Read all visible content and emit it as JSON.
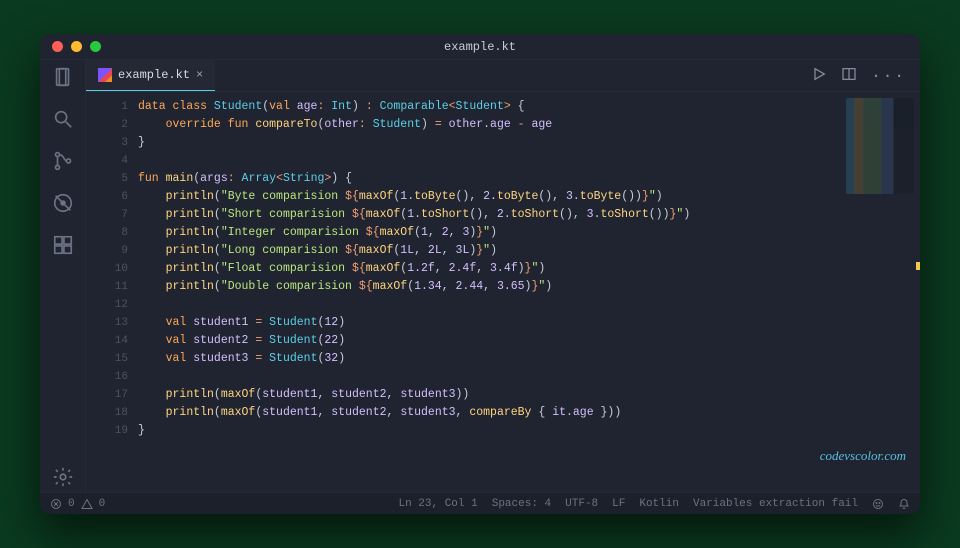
{
  "window": {
    "title": "example.kt"
  },
  "tabs": {
    "active": {
      "label": "example.kt"
    }
  },
  "watermark": "codevscolor.com",
  "status": {
    "errors": "0",
    "warnings": "0",
    "cursor": "Ln 23, Col 1",
    "spaces": "Spaces: 4",
    "encoding": "UTF-8",
    "eol": "LF",
    "language": "Kotlin",
    "message": "Variables extraction fail"
  },
  "code": {
    "lines": [
      {
        "n": 1,
        "tokens": [
          [
            "kw",
            "data class "
          ],
          [
            "type",
            "Student"
          ],
          [
            "pun",
            "("
          ],
          [
            "kw",
            "val "
          ],
          [
            "id",
            "age"
          ],
          [
            "op",
            ": "
          ],
          [
            "type",
            "Int"
          ],
          [
            "pun",
            ") "
          ],
          [
            "op",
            ": "
          ],
          [
            "type",
            "Comparable"
          ],
          [
            "op",
            "<"
          ],
          [
            "type",
            "Student"
          ],
          [
            "op",
            "> "
          ],
          [
            "pun",
            "{"
          ]
        ]
      },
      {
        "n": 2,
        "indent": 1,
        "tokens": [
          [
            "kw",
            "override fun "
          ],
          [
            "fn",
            "compareTo"
          ],
          [
            "pun",
            "("
          ],
          [
            "id",
            "other"
          ],
          [
            "op",
            ": "
          ],
          [
            "type",
            "Student"
          ],
          [
            "pun",
            ") "
          ],
          [
            "op",
            "= "
          ],
          [
            "id",
            "other"
          ],
          [
            "pun",
            "."
          ],
          [
            "id",
            "age"
          ],
          [
            "op",
            " - "
          ],
          [
            "id",
            "age"
          ]
        ]
      },
      {
        "n": 3,
        "tokens": [
          [
            "pun",
            "}"
          ]
        ]
      },
      {
        "n": 4,
        "tokens": []
      },
      {
        "n": 5,
        "tokens": [
          [
            "kw",
            "fun "
          ],
          [
            "fn",
            "main"
          ],
          [
            "pun",
            "("
          ],
          [
            "id",
            "args"
          ],
          [
            "op",
            ": "
          ],
          [
            "type",
            "Array"
          ],
          [
            "op",
            "<"
          ],
          [
            "type",
            "String"
          ],
          [
            "op",
            ">"
          ],
          [
            "pun",
            ") {"
          ]
        ]
      },
      {
        "n": 6,
        "indent": 1,
        "tokens": [
          [
            "fn",
            "println"
          ],
          [
            "pun",
            "("
          ],
          [
            "str",
            "\"Byte comparision "
          ],
          [
            "op",
            "${"
          ],
          [
            "fn",
            "maxOf"
          ],
          [
            "pun",
            "("
          ],
          [
            "num",
            "1"
          ],
          [
            "pun",
            "."
          ],
          [
            "fn",
            "toByte"
          ],
          [
            "pun",
            "(), "
          ],
          [
            "num",
            "2"
          ],
          [
            "pun",
            "."
          ],
          [
            "fn",
            "toByte"
          ],
          [
            "pun",
            "(), "
          ],
          [
            "num",
            "3"
          ],
          [
            "pun",
            "."
          ],
          [
            "fn",
            "toByte"
          ],
          [
            "pun",
            "())"
          ],
          [
            "op",
            "}"
          ],
          [
            "str",
            "\""
          ],
          [
            "pun",
            ")"
          ]
        ]
      },
      {
        "n": 7,
        "indent": 1,
        "tokens": [
          [
            "fn",
            "println"
          ],
          [
            "pun",
            "("
          ],
          [
            "str",
            "\"Short comparision "
          ],
          [
            "op",
            "${"
          ],
          [
            "fn",
            "maxOf"
          ],
          [
            "pun",
            "("
          ],
          [
            "num",
            "1"
          ],
          [
            "pun",
            "."
          ],
          [
            "fn",
            "toShort"
          ],
          [
            "pun",
            "(), "
          ],
          [
            "num",
            "2"
          ],
          [
            "pun",
            "."
          ],
          [
            "fn",
            "toShort"
          ],
          [
            "pun",
            "(), "
          ],
          [
            "num",
            "3"
          ],
          [
            "pun",
            "."
          ],
          [
            "fn",
            "toShort"
          ],
          [
            "pun",
            "())"
          ],
          [
            "op",
            "}"
          ],
          [
            "str",
            "\""
          ],
          [
            "pun",
            ")"
          ]
        ]
      },
      {
        "n": 8,
        "indent": 1,
        "tokens": [
          [
            "fn",
            "println"
          ],
          [
            "pun",
            "("
          ],
          [
            "str",
            "\"Integer comparision "
          ],
          [
            "op",
            "${"
          ],
          [
            "fn",
            "maxOf"
          ],
          [
            "pun",
            "("
          ],
          [
            "num",
            "1"
          ],
          [
            "pun",
            ", "
          ],
          [
            "num",
            "2"
          ],
          [
            "pun",
            ", "
          ],
          [
            "num",
            "3"
          ],
          [
            "pun",
            ")"
          ],
          [
            "op",
            "}"
          ],
          [
            "str",
            "\""
          ],
          [
            "pun",
            ")"
          ]
        ]
      },
      {
        "n": 9,
        "indent": 1,
        "tokens": [
          [
            "fn",
            "println"
          ],
          [
            "pun",
            "("
          ],
          [
            "str",
            "\"Long comparision "
          ],
          [
            "op",
            "${"
          ],
          [
            "fn",
            "maxOf"
          ],
          [
            "pun",
            "("
          ],
          [
            "num",
            "1L"
          ],
          [
            "pun",
            ", "
          ],
          [
            "num",
            "2L"
          ],
          [
            "pun",
            ", "
          ],
          [
            "num",
            "3L"
          ],
          [
            "pun",
            ")"
          ],
          [
            "op",
            "}"
          ],
          [
            "str",
            "\""
          ],
          [
            "pun",
            ")"
          ]
        ]
      },
      {
        "n": 10,
        "indent": 1,
        "tokens": [
          [
            "fn",
            "println"
          ],
          [
            "pun",
            "("
          ],
          [
            "str",
            "\"Float comparision "
          ],
          [
            "op",
            "${"
          ],
          [
            "fn",
            "maxOf"
          ],
          [
            "pun",
            "("
          ],
          [
            "num",
            "1.2f"
          ],
          [
            "pun",
            ", "
          ],
          [
            "num",
            "2.4f"
          ],
          [
            "pun",
            ", "
          ],
          [
            "num",
            "3.4f"
          ],
          [
            "pun",
            ")"
          ],
          [
            "op",
            "}"
          ],
          [
            "str",
            "\""
          ],
          [
            "pun",
            ")"
          ]
        ]
      },
      {
        "n": 11,
        "indent": 1,
        "tokens": [
          [
            "fn",
            "println"
          ],
          [
            "pun",
            "("
          ],
          [
            "str",
            "\"Double comparision "
          ],
          [
            "op",
            "${"
          ],
          [
            "fn",
            "maxOf"
          ],
          [
            "pun",
            "("
          ],
          [
            "num",
            "1.34"
          ],
          [
            "pun",
            ", "
          ],
          [
            "num",
            "2.44"
          ],
          [
            "pun",
            ", "
          ],
          [
            "num",
            "3.65"
          ],
          [
            "pun",
            ")"
          ],
          [
            "op",
            "}"
          ],
          [
            "str",
            "\""
          ],
          [
            "pun",
            ")"
          ]
        ]
      },
      {
        "n": 12,
        "tokens": []
      },
      {
        "n": 13,
        "indent": 1,
        "tokens": [
          [
            "kw",
            "val "
          ],
          [
            "id",
            "student1"
          ],
          [
            "op",
            " = "
          ],
          [
            "type",
            "Student"
          ],
          [
            "pun",
            "("
          ],
          [
            "num",
            "12"
          ],
          [
            "pun",
            ")"
          ]
        ]
      },
      {
        "n": 14,
        "indent": 1,
        "tokens": [
          [
            "kw",
            "val "
          ],
          [
            "id",
            "student2"
          ],
          [
            "op",
            " = "
          ],
          [
            "type",
            "Student"
          ],
          [
            "pun",
            "("
          ],
          [
            "num",
            "22"
          ],
          [
            "pun",
            ")"
          ]
        ]
      },
      {
        "n": 15,
        "indent": 1,
        "tokens": [
          [
            "kw",
            "val "
          ],
          [
            "id",
            "student3"
          ],
          [
            "op",
            " = "
          ],
          [
            "type",
            "Student"
          ],
          [
            "pun",
            "("
          ],
          [
            "num",
            "32"
          ],
          [
            "pun",
            ")"
          ]
        ]
      },
      {
        "n": 16,
        "tokens": []
      },
      {
        "n": 17,
        "indent": 1,
        "tokens": [
          [
            "fn",
            "println"
          ],
          [
            "pun",
            "("
          ],
          [
            "fn",
            "maxOf"
          ],
          [
            "pun",
            "("
          ],
          [
            "id",
            "student1"
          ],
          [
            "pun",
            ", "
          ],
          [
            "id",
            "student2"
          ],
          [
            "pun",
            ", "
          ],
          [
            "id",
            "student3"
          ],
          [
            "pun",
            "))"
          ]
        ]
      },
      {
        "n": 18,
        "indent": 1,
        "tokens": [
          [
            "fn",
            "println"
          ],
          [
            "pun",
            "("
          ],
          [
            "fn",
            "maxOf"
          ],
          [
            "pun",
            "("
          ],
          [
            "id",
            "student1"
          ],
          [
            "pun",
            ", "
          ],
          [
            "id",
            "student2"
          ],
          [
            "pun",
            ", "
          ],
          [
            "id",
            "student3"
          ],
          [
            "pun",
            ", "
          ],
          [
            "fn",
            "compareBy"
          ],
          [
            "pun",
            " { "
          ],
          [
            "id",
            "it"
          ],
          [
            "pun",
            "."
          ],
          [
            "id",
            "age"
          ],
          [
            "pun",
            " }))"
          ]
        ]
      },
      {
        "n": 19,
        "tokens": [
          [
            "pun",
            "}"
          ]
        ]
      }
    ]
  }
}
